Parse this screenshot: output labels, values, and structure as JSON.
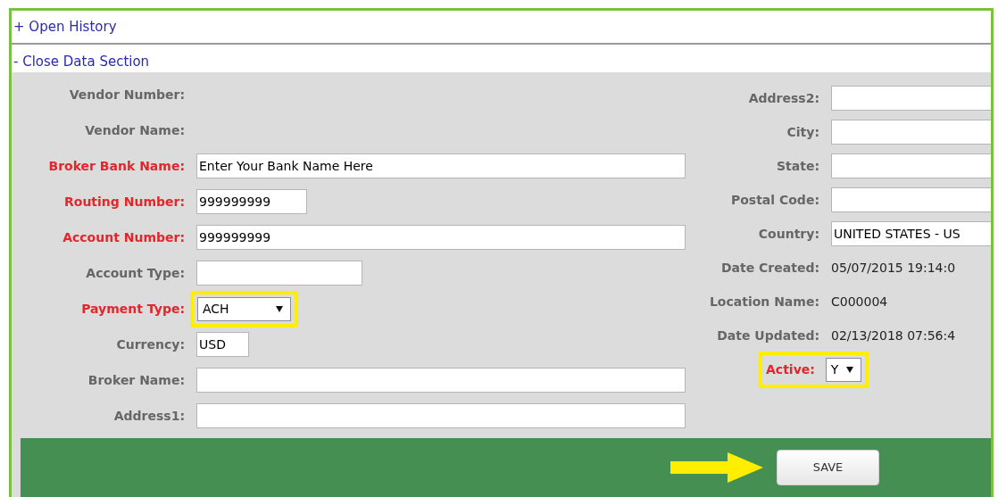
{
  "sections": [
    {
      "label": "+ Open History"
    },
    {
      "label": "- Close Data Section"
    }
  ],
  "left_fields": [
    {
      "label": "Vendor Number:",
      "kind": "text",
      "required": false
    },
    {
      "label": "Vendor Name:",
      "kind": "text",
      "required": false
    },
    {
      "label": "Broker Bank Name:",
      "kind": "input",
      "value": "Enter Your Bank Name Here",
      "required": true
    },
    {
      "label": "Routing Number:",
      "kind": "input",
      "value": "999999999",
      "required": true
    },
    {
      "label": "Account Number:",
      "kind": "input",
      "required": true,
      "value": "999999999"
    },
    {
      "label": "Account Type:",
      "kind": "input",
      "required": false
    },
    {
      "label": "Payment Type:",
      "kind": "select",
      "value": "ACH",
      "required": true,
      "highlighted": true
    },
    {
      "label": "Currency:",
      "kind": "input",
      "value": "USD",
      "required": false
    },
    {
      "label": "Broker Name:",
      "kind": "input",
      "required": false
    },
    {
      "label": "Address1:",
      "kind": "input",
      "required": false
    }
  ],
  "right_fields": [
    {
      "label": "Address2:",
      "kind": "input",
      "required": false
    },
    {
      "label": "City:",
      "kind": "input",
      "required": false
    },
    {
      "label": "State:",
      "kind": "input",
      "required": false
    },
    {
      "label": "Postal Code:",
      "kind": "input",
      "required": false
    },
    {
      "label": "Country:",
      "kind": "input",
      "value": "UNITED STATES - US",
      "required": false
    },
    {
      "label": "Date Created:",
      "kind": "text",
      "value": "05/07/2015 19:14:0",
      "required": false
    },
    {
      "label": "Location Name:",
      "kind": "text",
      "value": "C000004",
      "required": false
    },
    {
      "label": "Date Updated:",
      "kind": "text",
      "value": "02/13/2018 07:56:4",
      "required": false
    },
    {
      "label": "Active:",
      "kind": "select",
      "value": "Y",
      "required": true,
      "highlighted": true
    }
  ],
  "save_button": "SAVE"
}
